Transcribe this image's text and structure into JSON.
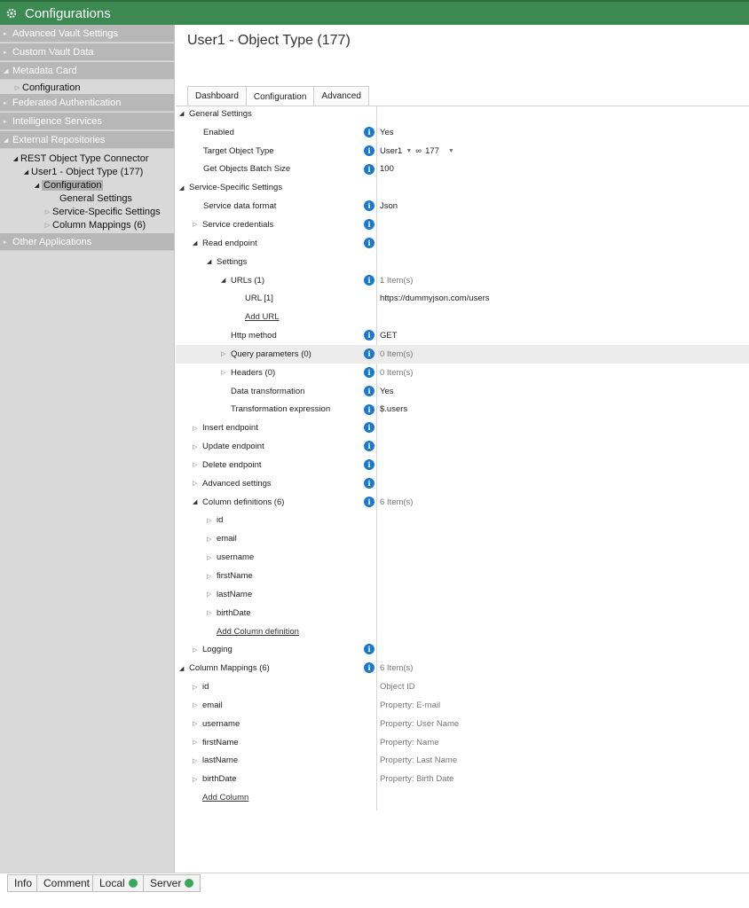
{
  "app": {
    "title": "Configurations"
  },
  "sidebar": {
    "sections": [
      {
        "label": "Advanced Vault Settings"
      },
      {
        "label": "Custom Vault Data"
      },
      {
        "label": "Metadata Card"
      },
      {
        "label": "Federated Authentication"
      },
      {
        "label": "Intelligence Services"
      },
      {
        "label": "External Repositories"
      },
      {
        "label": "Other Applications"
      }
    ],
    "metadata_children": [
      {
        "label": "Configuration"
      }
    ],
    "external_children": [
      {
        "label": "REST Object Type Connector"
      },
      {
        "label": "User1 - Object Type (177)"
      },
      {
        "label": "Configuration"
      },
      {
        "label": "General Settings"
      },
      {
        "label": "Service-Specific Settings"
      },
      {
        "label": "Column Mappings (6)"
      }
    ]
  },
  "main": {
    "title": "User1 - Object Type (177)",
    "tabs": [
      {
        "label": "Dashboard"
      },
      {
        "label": "Configuration"
      },
      {
        "label": "Advanced"
      }
    ],
    "rows": [
      {
        "label": "General Settings",
        "value": "",
        "toggle": "open"
      },
      {
        "label": "Enabled",
        "value": "Yes"
      },
      {
        "label": "Target Object Type",
        "value": "User1",
        "value2": "177"
      },
      {
        "label": "Get Objects Batch Size",
        "value": "100"
      },
      {
        "label": "Service-Specific Settings",
        "value": "",
        "toggle": "open"
      },
      {
        "label": "Service data format",
        "value": "Json"
      },
      {
        "label": "Service credentials",
        "value": "",
        "toggle": "closed"
      },
      {
        "label": "Read endpoint",
        "value": "",
        "toggle": "open"
      },
      {
        "label": "Settings",
        "value": "",
        "toggle": "open"
      },
      {
        "label": "URLs (1)",
        "value": "1 Item(s)",
        "toggle": "open"
      },
      {
        "label": "URL [1]",
        "value": "https://dummyjson.com/users"
      },
      {
        "label": "Add URL",
        "value": ""
      },
      {
        "label": "Http method",
        "value": "GET"
      },
      {
        "label": "Query parameters (0)",
        "value": "0 Item(s)",
        "toggle": "closed"
      },
      {
        "label": "Headers (0)",
        "value": "0 Item(s)",
        "toggle": "closed"
      },
      {
        "label": "Data transformation",
        "value": "Yes"
      },
      {
        "label": "Transformation expression",
        "value": "$.users"
      },
      {
        "label": "Insert endpoint",
        "value": "",
        "toggle": "closed"
      },
      {
        "label": "Update endpoint",
        "value": "",
        "toggle": "closed"
      },
      {
        "label": "Delete endpoint",
        "value": "",
        "toggle": "closed"
      },
      {
        "label": "Advanced settings",
        "value": "",
        "toggle": "closed"
      },
      {
        "label": "Column definitions (6)",
        "value": "6 Item(s)",
        "toggle": "open"
      },
      {
        "label": "id",
        "value": "",
        "toggle": "closed"
      },
      {
        "label": "email",
        "value": "",
        "toggle": "closed"
      },
      {
        "label": "username",
        "value": "",
        "toggle": "closed"
      },
      {
        "label": "firstName",
        "value": "",
        "toggle": "closed"
      },
      {
        "label": "lastName",
        "value": "",
        "toggle": "closed"
      },
      {
        "label": "birthDate",
        "value": "",
        "toggle": "closed"
      },
      {
        "label": "Add Column definition",
        "value": ""
      },
      {
        "label": "Logging",
        "value": "",
        "toggle": "closed"
      },
      {
        "label": "Column Mappings (6)",
        "value": "6 Item(s)",
        "toggle": "open"
      },
      {
        "label": "id",
        "value": "Object ID",
        "toggle": "closed"
      },
      {
        "label": "email",
        "value": "Property: E-mail",
        "toggle": "closed"
      },
      {
        "label": "username",
        "value": "Property: User Name",
        "toggle": "closed"
      },
      {
        "label": "firstName",
        "value": "Property: Name",
        "toggle": "closed"
      },
      {
        "label": "lastName",
        "value": "Property: Last Name",
        "toggle": "closed"
      },
      {
        "label": "birthDate",
        "value": "Property: Birth Date",
        "toggle": "closed"
      },
      {
        "label": "Add Column",
        "value": ""
      }
    ]
  },
  "statusbar": {
    "info": "Info",
    "comment": "Comment",
    "local": "Local",
    "server": "Server"
  },
  "colors": {
    "accent": "#3c8a52",
    "info": "#1e78c8",
    "status_ok": "#3ba75a"
  }
}
